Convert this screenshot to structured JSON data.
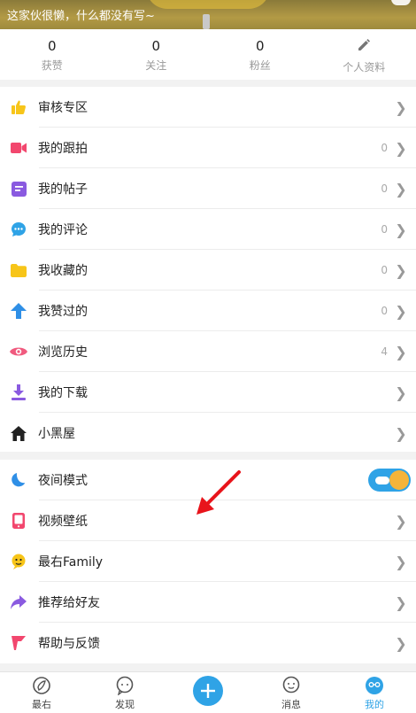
{
  "profile": {
    "bio": "这家伙很懒，什么都没有写~"
  },
  "stats": [
    {
      "value": "0",
      "label": "获赞"
    },
    {
      "value": "0",
      "label": "关注"
    },
    {
      "value": "0",
      "label": "粉丝"
    },
    {
      "value": "",
      "label": "个人资料"
    }
  ],
  "menu1": [
    {
      "label": "审核专区",
      "count": "",
      "icon": "thumbs-up-icon"
    },
    {
      "label": "我的跟拍",
      "count": "0",
      "icon": "video-camera-icon"
    },
    {
      "label": "我的帖子",
      "count": "0",
      "icon": "post-icon"
    },
    {
      "label": "我的评论",
      "count": "0",
      "icon": "comment-icon"
    },
    {
      "label": "我收藏的",
      "count": "0",
      "icon": "folder-icon"
    },
    {
      "label": "我赞过的",
      "count": "0",
      "icon": "up-arrow-icon"
    },
    {
      "label": "浏览历史",
      "count": "4",
      "icon": "eye-icon"
    },
    {
      "label": "我的下载",
      "count": "",
      "icon": "download-icon"
    },
    {
      "label": "小黑屋",
      "count": "",
      "icon": "house-icon"
    }
  ],
  "menu2": [
    {
      "label": "夜间模式",
      "icon": "moon-icon"
    },
    {
      "label": "视频壁纸",
      "icon": "phone-icon"
    },
    {
      "label": "最右Family",
      "icon": "family-face-icon"
    },
    {
      "label": "推荐给好友",
      "icon": "share-arrow-icon"
    },
    {
      "label": "帮助与反馈",
      "icon": "flag-icon"
    }
  ],
  "night_mode_on": true,
  "tabs": [
    {
      "label": "最右",
      "icon": "zuiyou-icon"
    },
    {
      "label": "发现",
      "icon": "discover-icon"
    },
    {
      "label": "",
      "icon": "plus-icon"
    },
    {
      "label": "消息",
      "icon": "message-icon"
    },
    {
      "label": "我的",
      "icon": "profile-icon"
    }
  ],
  "colors": {
    "accent": "#2fa3e6",
    "annotation": "#e8141b"
  }
}
